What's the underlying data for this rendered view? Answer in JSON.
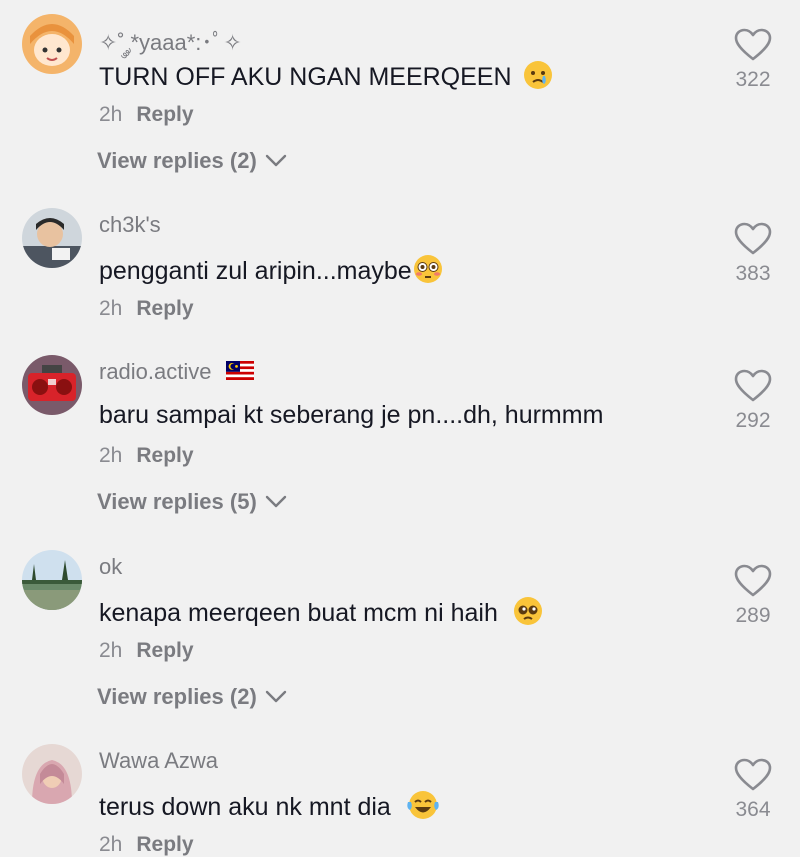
{
  "comments": [
    {
      "username": "✧˚ ༘*yaaa*:･ﾟ✧",
      "text": "TURN OFF AKU NGAN MEERQEEN",
      "emoji": "crying-face-emoji",
      "time": "2h",
      "reply_label": "Reply",
      "likes": "322",
      "view_replies": "View replies (2)"
    },
    {
      "username": "ch3k's",
      "text": "pengganti zul aripin...maybe",
      "emoji": "flushed-face-emoji",
      "time": "2h",
      "reply_label": "Reply",
      "likes": "383"
    },
    {
      "username": "radio.active",
      "badge": "malaysia-flag-icon",
      "text": "baru sampai kt seberang je pn....dh, hurmmm",
      "time": "2h",
      "reply_label": "Reply",
      "likes": "292",
      "view_replies": "View replies (5)"
    },
    {
      "username": "ok",
      "text": "kenapa meerqeen buat mcm ni haih",
      "emoji": "pleading-face-emoji",
      "time": "2h",
      "reply_label": "Reply",
      "likes": "289",
      "view_replies": "View replies (2)"
    },
    {
      "username": "Wawa Azwa",
      "text": "terus down aku nk mnt dia",
      "emoji": "tears-of-joy-emoji",
      "time": "2h",
      "reply_label": "Reply",
      "likes": "364"
    }
  ],
  "colors": {
    "background": "#f1f1f1",
    "primary_text": "#161823",
    "secondary_text": "#7a7b80"
  }
}
